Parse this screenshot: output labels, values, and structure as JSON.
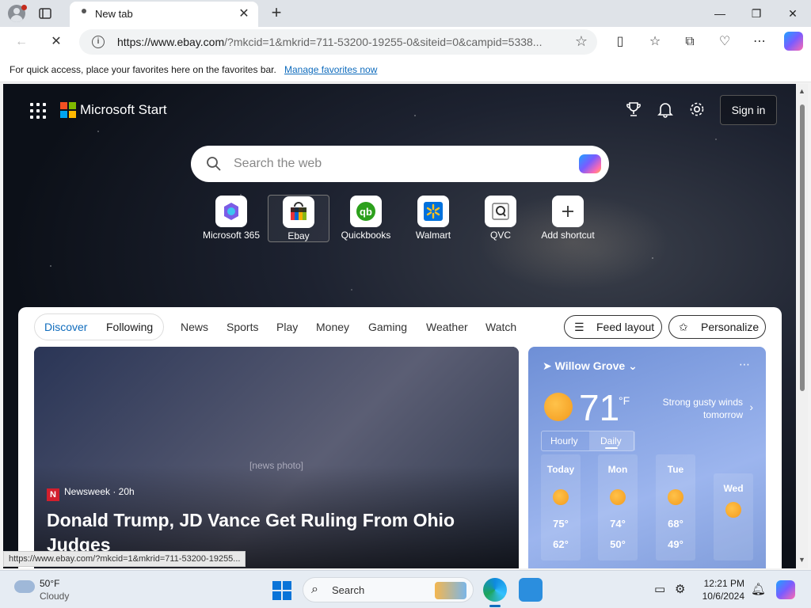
{
  "browser": {
    "tab_title": "New tab",
    "url_host": "https://www.ebay.com",
    "url_rest": "/?mkcid=1&mkrid=711-53200-19255-0&siteid=0&campid=5338...",
    "favorites_message": "For quick access, place your favorites here on the favorites bar.",
    "favorites_link": "Manage favorites now",
    "status_url": "https://www.ebay.com/?mkcid=1&mkrid=711-53200-19255..."
  },
  "start": {
    "brand": "Microsoft Start",
    "sign_in": "Sign in",
    "search_placeholder": "Search the web",
    "shortcuts": [
      {
        "label": "Microsoft 365",
        "icon": "microsoft-365-icon"
      },
      {
        "label": "Ebay",
        "icon": "ebay-bag-icon"
      },
      {
        "label": "Quickbooks",
        "icon": "quickbooks-icon"
      },
      {
        "label": "Walmart",
        "icon": "walmart-spark-icon"
      },
      {
        "label": "QVC",
        "icon": "qvc-icon"
      },
      {
        "label": "Add shortcut",
        "icon": "plus-icon"
      }
    ]
  },
  "feed": {
    "pill_tabs": [
      "Discover",
      "Following"
    ],
    "nav": [
      "News",
      "Sports",
      "Play",
      "Money",
      "Gaming",
      "Weather",
      "Watch"
    ],
    "feed_layout": "Feed layout",
    "personalize": "Personalize",
    "hero": {
      "source_letter": "N",
      "source": "Newsweek · 20h",
      "headline": "Donald Trump, JD Vance Get Ruling From Ohio Judges"
    }
  },
  "weather": {
    "location": "Willow Grove",
    "temp": "71",
    "unit": "°F",
    "alert": "Strong gusty winds tomorrow",
    "tabs": [
      "Hourly",
      "Daily"
    ],
    "days": [
      {
        "name": "Today",
        "hi": "75°",
        "lo": "62°"
      },
      {
        "name": "Mon",
        "hi": "74°",
        "lo": "50°"
      },
      {
        "name": "Tue",
        "hi": "68°",
        "lo": "49°"
      },
      {
        "name": "Wed",
        "hi": "",
        "lo": ""
      }
    ]
  },
  "taskbar": {
    "weather_temp": "50°F",
    "weather_cond": "Cloudy",
    "search": "Search",
    "time": "12:21 PM",
    "date": "10/6/2024"
  },
  "colors": {
    "ms_red": "#f25022",
    "ms_green": "#7fba00",
    "ms_blue": "#00a4ef",
    "ms_yellow": "#ffb900",
    "link": "#0f6cbd"
  }
}
